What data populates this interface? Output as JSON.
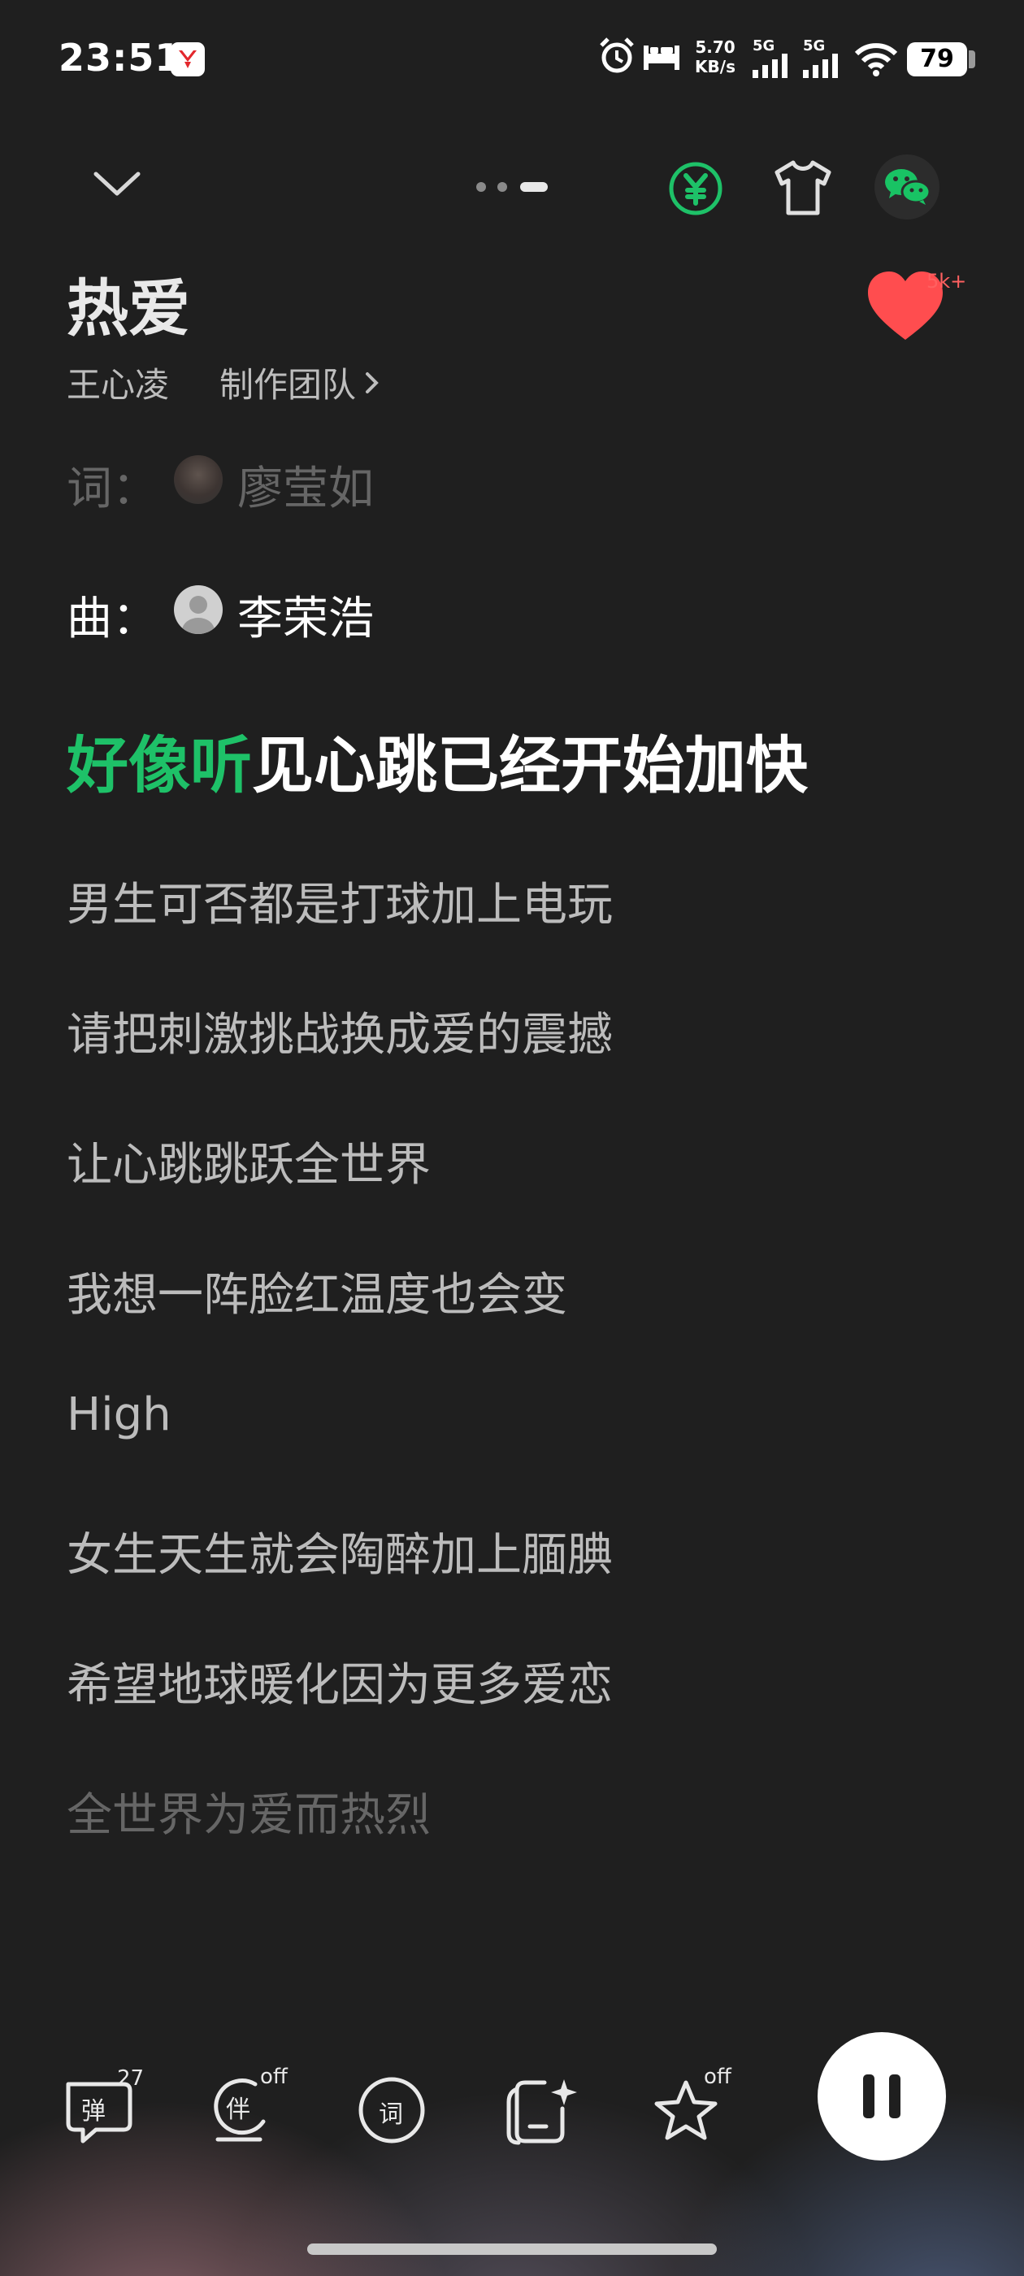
{
  "status_bar": {
    "time": "23:51",
    "net_rate_value": "5.70",
    "net_rate_unit": "KB/s",
    "signal_1_label": "5G",
    "signal_2_label": "5G",
    "battery": "79",
    "icons": [
      "app-badge-icon",
      "alarm-icon",
      "bed-icon",
      "signal-icon",
      "signal-icon",
      "wifi-icon",
      "battery-icon"
    ]
  },
  "header": {
    "collapse_icon": "chevron-down-icon",
    "page_indicator_active": 3,
    "page_indicator_total": 3,
    "buttons": [
      "yuan-coin-icon",
      "tshirt-icon",
      "wechat-icon"
    ]
  },
  "song": {
    "title": "热爱",
    "artist": "王心凌",
    "team_label": "制作团队",
    "like_count": "5k+"
  },
  "credits": {
    "lyricist_label": "词：",
    "lyricist_name": "廖莹如",
    "composer_label": "曲：",
    "composer_name": "李荣浩"
  },
  "lyrics": {
    "active_sung": "好像听",
    "active_rest": "见心跳已经开始加快",
    "lines": [
      "男生可否都是打球加上电玩",
      "请把刺激挑战换成爱的震撼",
      "让心跳跳跃全世界",
      "我想一阵脸红温度也会变",
      "High",
      "女生天生就会陶醉加上腼腆",
      "希望地球暖化因为更多爱恋",
      "全世界为爱而热烈"
    ]
  },
  "controls": {
    "danmu_label": "弹",
    "danmu_count": "27",
    "accompany_label": "伴",
    "accompany_state": "off",
    "lyrics_label": "词",
    "effect_state": "off"
  },
  "colors": {
    "accent_green": "#1ec168",
    "like_red": "#ff4d4f",
    "background": "#1f1f1f"
  }
}
